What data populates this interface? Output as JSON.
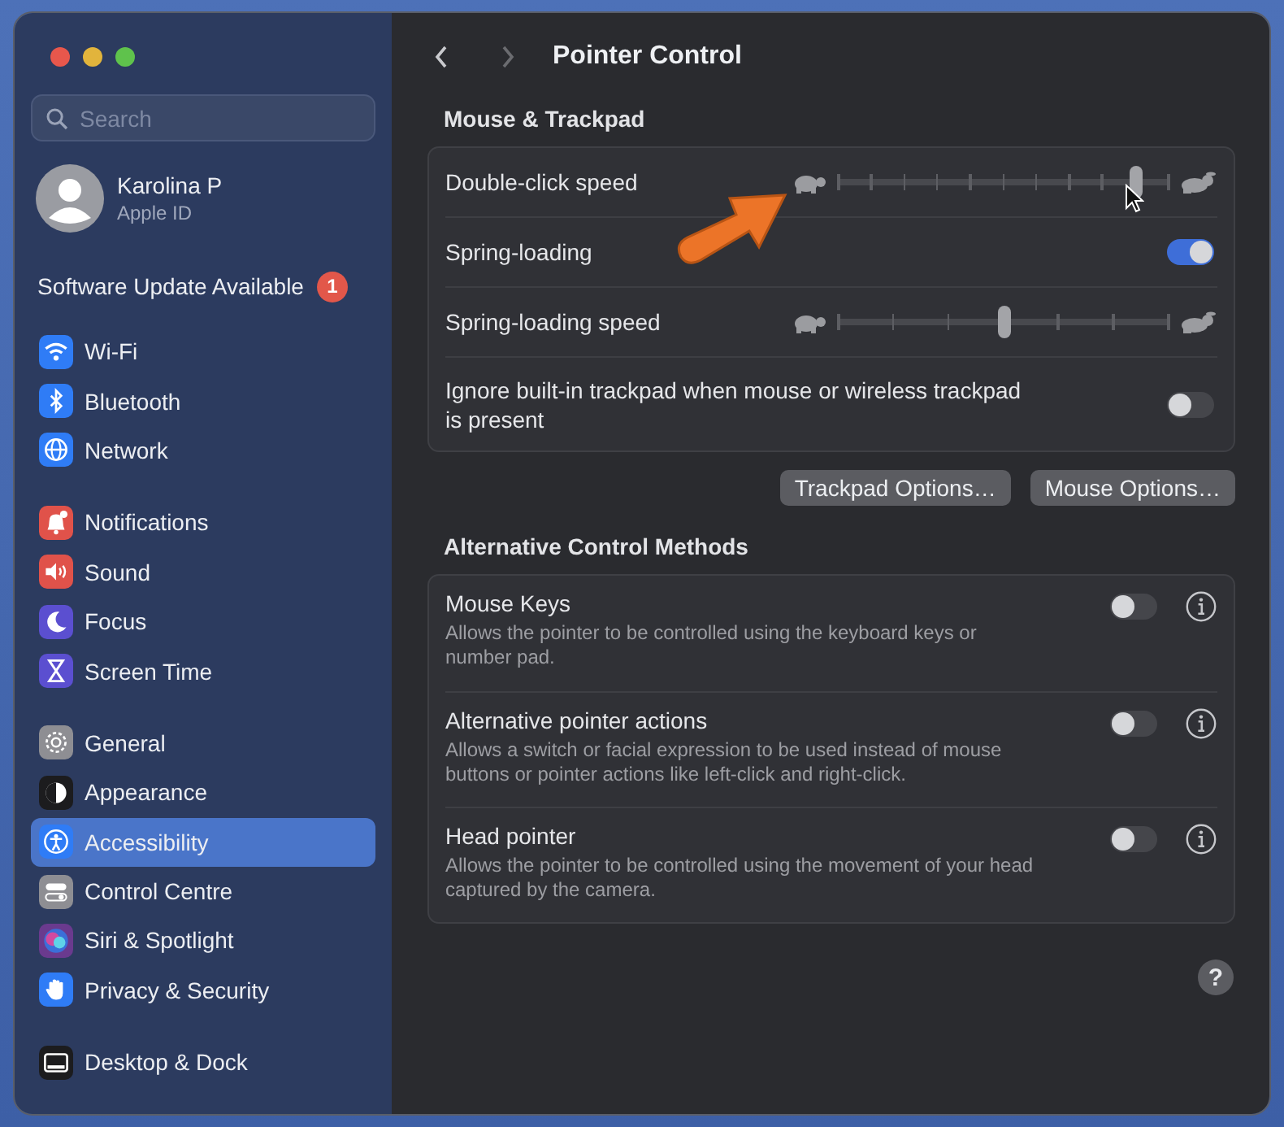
{
  "window": {
    "title": "Pointer Control"
  },
  "sidebar": {
    "search": {
      "placeholder": "Search"
    },
    "account": {
      "name": "Karolina P",
      "subtitle": "Apple ID"
    },
    "update": {
      "label": "Software Update Available",
      "badge": "1"
    },
    "sections": [
      {
        "items": [
          {
            "label": "Wi-Fi",
            "color": "#2f7cf6",
            "selected": false
          },
          {
            "label": "Bluetooth",
            "color": "#2f7cf6",
            "selected": false
          },
          {
            "label": "Network",
            "color": "#2f7cf6",
            "selected": false
          }
        ]
      },
      {
        "items": [
          {
            "label": "Notifications",
            "color": "#e0524a",
            "selected": false
          },
          {
            "label": "Sound",
            "color": "#e0524a",
            "selected": false
          },
          {
            "label": "Focus",
            "color": "#5b4fd0",
            "selected": false
          },
          {
            "label": "Screen Time",
            "color": "#5b4fd0",
            "selected": false
          }
        ]
      },
      {
        "items": [
          {
            "label": "General",
            "color": "#8e8e93",
            "selected": false
          },
          {
            "label": "Appearance",
            "color": "#1c1c1e",
            "selected": false
          },
          {
            "label": "Accessibility",
            "color": "#2f7cf6",
            "selected": true
          },
          {
            "label": "Control Centre",
            "color": "#8e8e93",
            "selected": false
          },
          {
            "label": "Siri & Spotlight",
            "color": "#6a3a8e",
            "selected": false
          },
          {
            "label": "Privacy & Security",
            "color": "#2f7cf6",
            "selected": false
          }
        ]
      },
      {
        "items": [
          {
            "label": "Desktop & Dock",
            "color": "#1c1c1e",
            "selected": false
          }
        ]
      }
    ]
  },
  "groups": [
    {
      "title": "Mouse & Trackpad",
      "rows": [
        {
          "kind": "slider",
          "label": "Double-click speed",
          "level": 0.9
        },
        {
          "kind": "toggle",
          "label": "Spring-loading",
          "on": true
        },
        {
          "kind": "slider",
          "label": "Spring-loading speed",
          "level": 0.5
        },
        {
          "kind": "toggle",
          "label": "Ignore built-in trackpad when mouse or wireless trackpad is present",
          "on": false
        }
      ],
      "buttons": [
        "Trackpad Options…",
        "Mouse Options…"
      ]
    },
    {
      "title": "Alternative Control Methods",
      "rows": [
        {
          "kind": "info",
          "label": "Mouse Keys",
          "description": "Allows the pointer to be controlled using the keyboard keys or number pad.",
          "on": false
        },
        {
          "kind": "info",
          "label": "Alternative pointer actions",
          "description": "Allows a switch or facial expression to be used instead of mouse buttons or pointer actions like left-click and right-click.",
          "on": false
        },
        {
          "kind": "info",
          "label": "Head pointer",
          "description": "Allows the pointer to be controlled using the movement of your head captured by the camera.",
          "on": false
        }
      ]
    }
  ],
  "help": "?"
}
